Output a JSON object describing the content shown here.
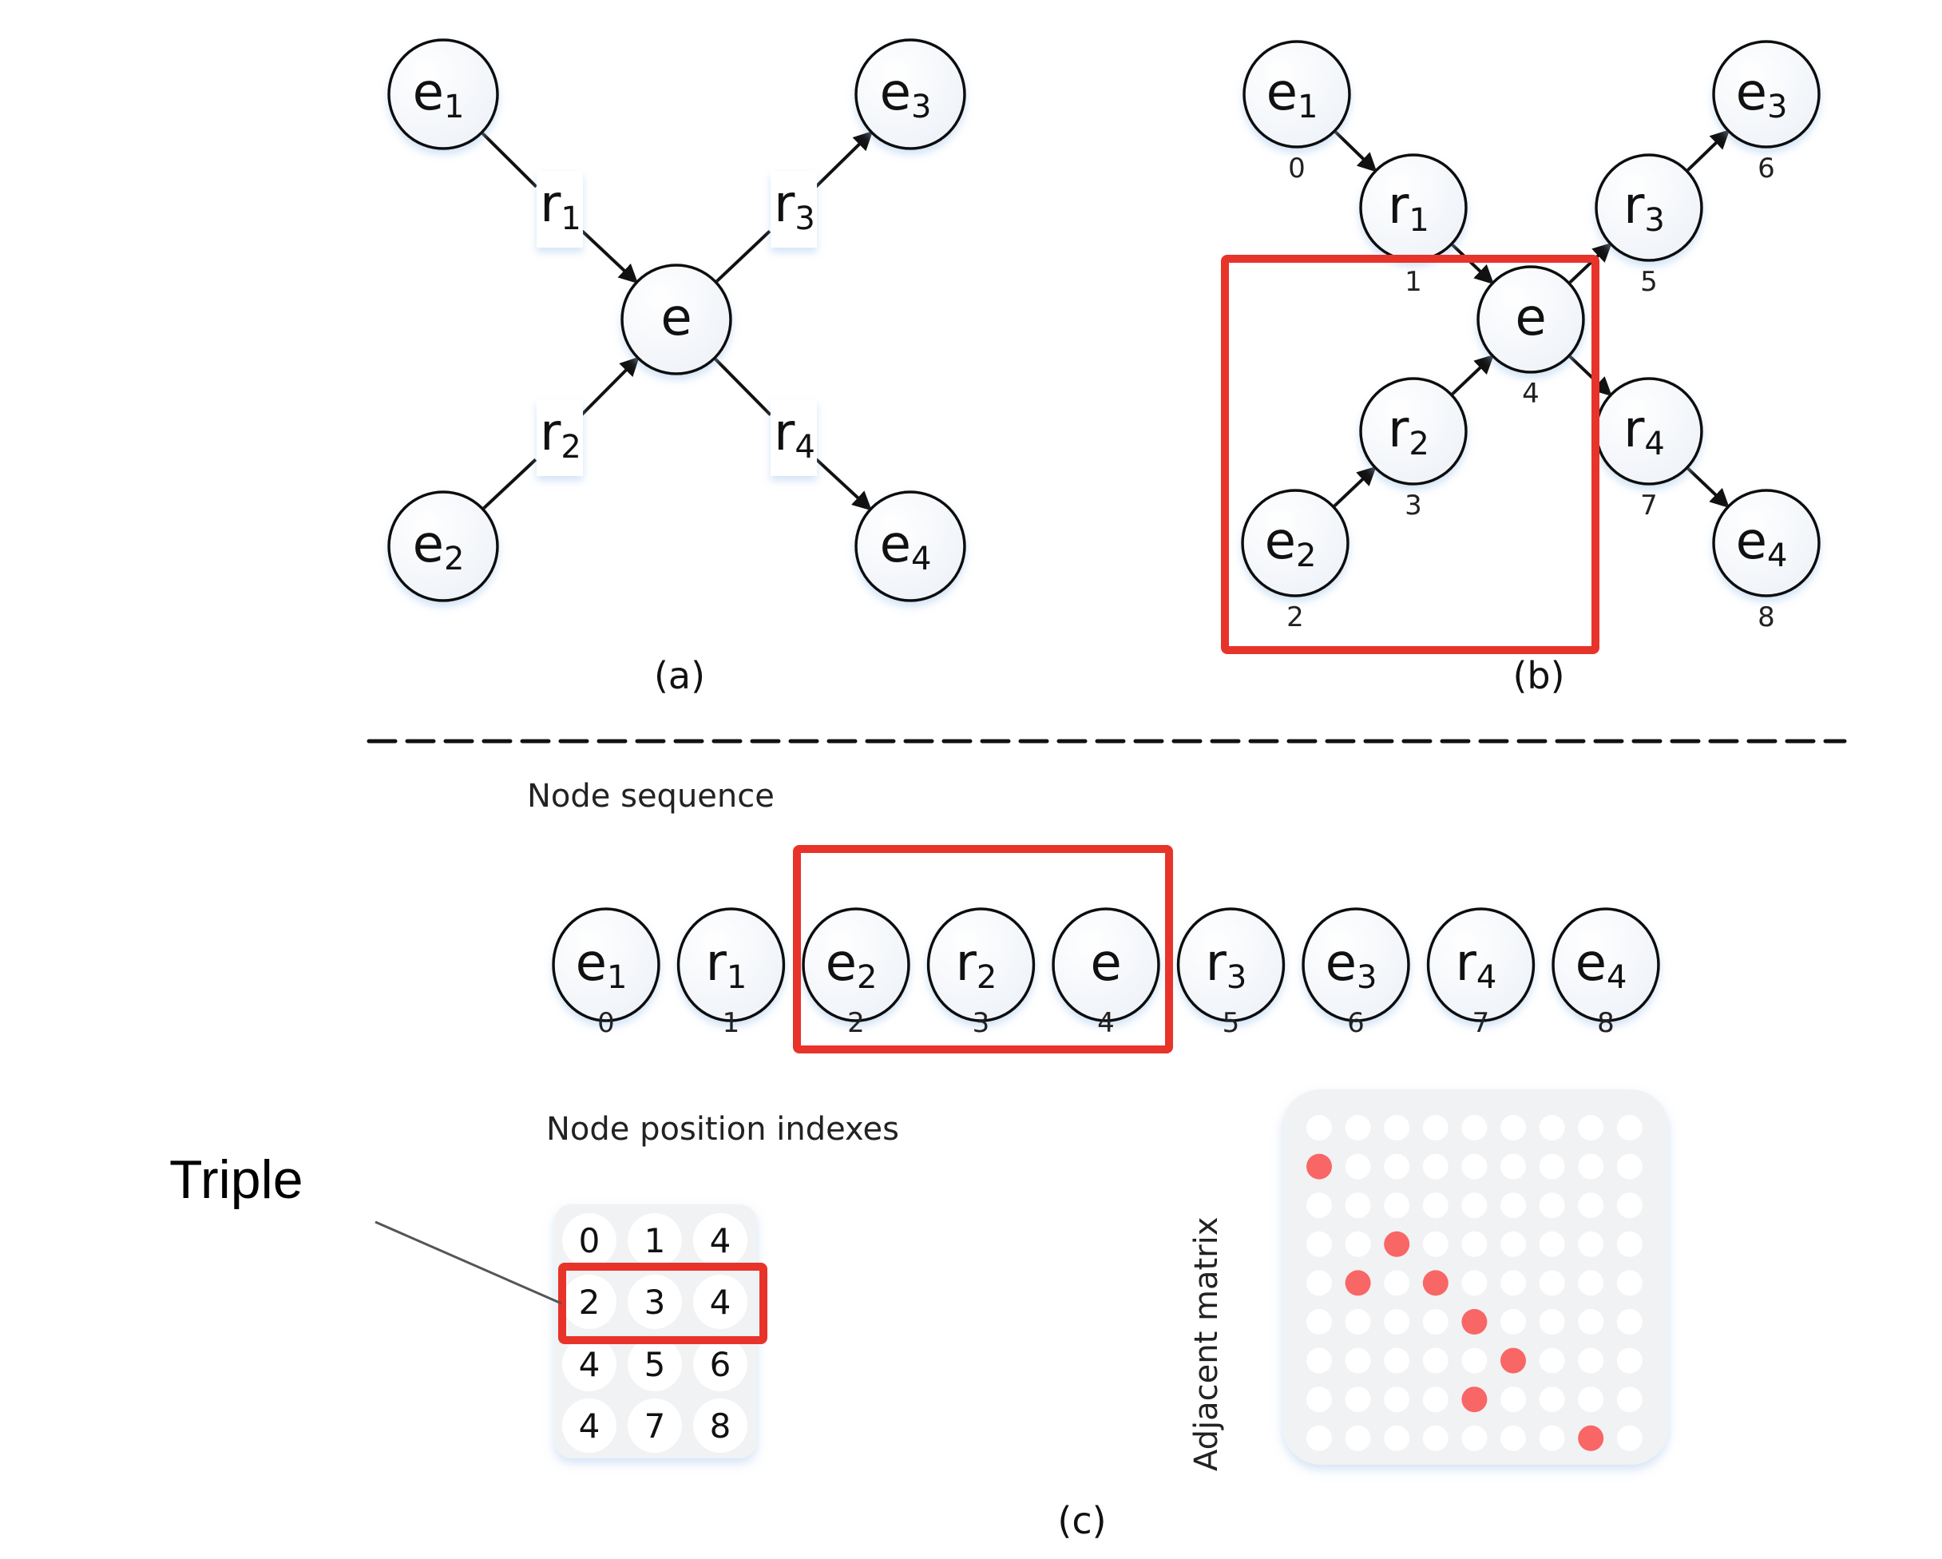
{
  "captions": {
    "a": "(a)",
    "b": "(b)",
    "c": "(c)"
  },
  "labels": {
    "node_sequence": "Node sequence",
    "node_position_indexes": "Node position indexes",
    "adjacent_matrix": "Adjacent matrix",
    "triple": "Triple"
  },
  "colors": {
    "highlight": "#E8332A",
    "matrix_on": "#F96666",
    "panel_bg": "#F1F2F4"
  },
  "graph_a": {
    "center": {
      "id": "e",
      "base": "e",
      "sub": ""
    },
    "entities": [
      {
        "id": "e1",
        "base": "e",
        "sub": "1"
      },
      {
        "id": "e2",
        "base": "e",
        "sub": "2"
      },
      {
        "id": "e3",
        "base": "e",
        "sub": "3"
      },
      {
        "id": "e4",
        "base": "e",
        "sub": "4"
      }
    ],
    "relations": [
      {
        "id": "r1",
        "base": "r",
        "sub": "1",
        "from": "e1",
        "to": "e"
      },
      {
        "id": "r2",
        "base": "r",
        "sub": "2",
        "from": "e2",
        "to": "e"
      },
      {
        "id": "r3",
        "base": "r",
        "sub": "3",
        "from": "e",
        "to": "e3"
      },
      {
        "id": "r4",
        "base": "r",
        "sub": "4",
        "from": "e",
        "to": "e4"
      }
    ]
  },
  "graph_b": {
    "nodes": [
      {
        "id": "e1",
        "base": "e",
        "sub": "1",
        "index": "0"
      },
      {
        "id": "r1",
        "base": "r",
        "sub": "1",
        "index": "1"
      },
      {
        "id": "e2",
        "base": "e",
        "sub": "2",
        "index": "2"
      },
      {
        "id": "r2",
        "base": "r",
        "sub": "2",
        "index": "3"
      },
      {
        "id": "e",
        "base": "e",
        "sub": "",
        "index": "4"
      },
      {
        "id": "r3",
        "base": "r",
        "sub": "3",
        "index": "5"
      },
      {
        "id": "e3",
        "base": "e",
        "sub": "3",
        "index": "6"
      },
      {
        "id": "r4",
        "base": "r",
        "sub": "4",
        "index": "7"
      },
      {
        "id": "e4",
        "base": "e",
        "sub": "4",
        "index": "8"
      }
    ],
    "edges": [
      [
        "e1",
        "r1"
      ],
      [
        "r1",
        "e"
      ],
      [
        "e2",
        "r2"
      ],
      [
        "r2",
        "e"
      ],
      [
        "e",
        "r3"
      ],
      [
        "r3",
        "e3"
      ],
      [
        "e",
        "r4"
      ],
      [
        "r4",
        "e4"
      ]
    ],
    "highlighted": [
      "e2",
      "r2",
      "e"
    ]
  },
  "node_sequence": {
    "items": [
      {
        "base": "e",
        "sub": "1",
        "index": "0"
      },
      {
        "base": "r",
        "sub": "1",
        "index": "1"
      },
      {
        "base": "e",
        "sub": "2",
        "index": "2"
      },
      {
        "base": "r",
        "sub": "2",
        "index": "3"
      },
      {
        "base": "e",
        "sub": "",
        "index": "4"
      },
      {
        "base": "r",
        "sub": "3",
        "index": "5"
      },
      {
        "base": "e",
        "sub": "3",
        "index": "6"
      },
      {
        "base": "r",
        "sub": "4",
        "index": "7"
      },
      {
        "base": "e",
        "sub": "4",
        "index": "8"
      }
    ],
    "highlight_range": [
      2,
      4
    ]
  },
  "position_indexes": {
    "rows": [
      [
        "0",
        "1",
        "4"
      ],
      [
        "2",
        "3",
        "4"
      ],
      [
        "4",
        "5",
        "6"
      ],
      [
        "4",
        "7",
        "8"
      ]
    ],
    "highlighted_row": 1
  },
  "adjacent_matrix": {
    "size": 9,
    "ones": [
      [
        1,
        0
      ],
      [
        3,
        2
      ],
      [
        4,
        1
      ],
      [
        4,
        3
      ],
      [
        5,
        4
      ],
      [
        6,
        5
      ],
      [
        7,
        4
      ],
      [
        8,
        7
      ]
    ]
  }
}
